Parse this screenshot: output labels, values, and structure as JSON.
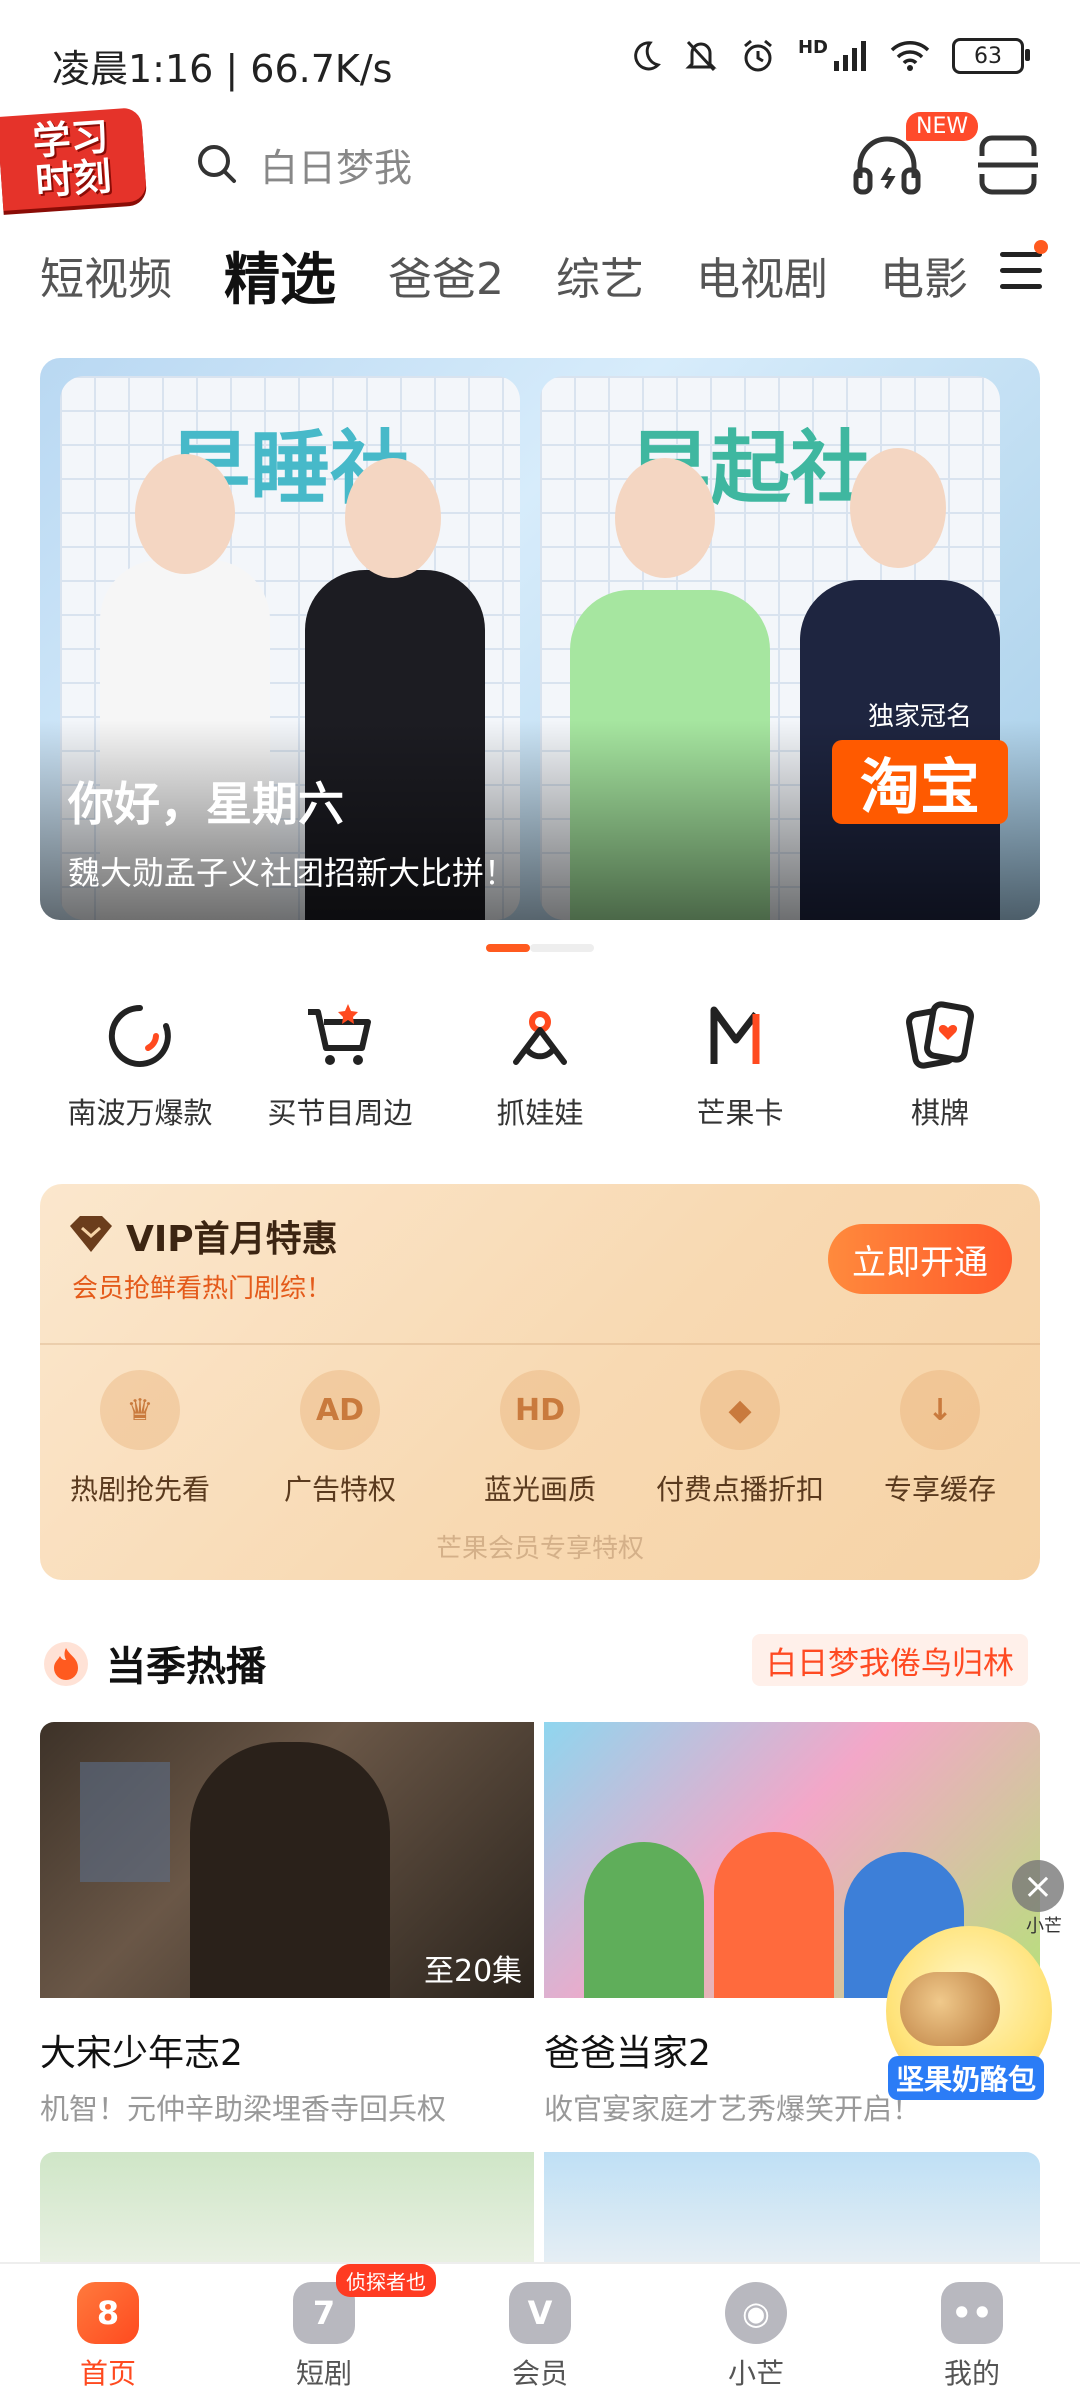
{
  "status_bar": {
    "time": "凌晨1:16 | 66.7K/s",
    "battery": "63",
    "net_type": "HD"
  },
  "header": {
    "logo_line1": "学习",
    "logo_line2": "时刻",
    "search_placeholder": "白日梦我",
    "new_badge": "NEW"
  },
  "tabs": [
    {
      "label": "短视频"
    },
    {
      "label": "精选"
    },
    {
      "label": "爸爸2"
    },
    {
      "label": "综艺"
    },
    {
      "label": "电视剧"
    },
    {
      "label": "电影"
    }
  ],
  "banner": {
    "board_left": "早睡社",
    "board_right": "早起社",
    "title": "你好，星期六",
    "subtitle": "魏大勋孟子义社团招新大比拼！",
    "sponsor_label": "独家冠名",
    "sponsor_name": "淘宝",
    "carousel_active_index": 0
  },
  "quick_entries": [
    {
      "label": "南波万爆款",
      "icon": "circle-swoosh-icon"
    },
    {
      "label": "买节目周边",
      "icon": "shopping-cart-icon"
    },
    {
      "label": "抓娃娃",
      "icon": "claw-machine-icon"
    },
    {
      "label": "芒果卡",
      "icon": "mango-m-icon"
    },
    {
      "label": "棋牌",
      "icon": "cards-icon"
    }
  ],
  "vip": {
    "title": "VIP首月特惠",
    "subtitle": "会员抢鲜看热门剧综！",
    "button": "立即开通",
    "perks": [
      {
        "label": "热剧抢先看",
        "icon": "sofa-icon",
        "glyph": "♛"
      },
      {
        "label": "广告特权",
        "icon": "ad-icon",
        "glyph": "AD"
      },
      {
        "label": "蓝光画质",
        "icon": "hd-icon",
        "glyph": "HD"
      },
      {
        "label": "付费点播折扣",
        "icon": "tag-icon",
        "glyph": "◆"
      },
      {
        "label": "专享缓存",
        "icon": "download-icon",
        "glyph": "↓"
      }
    ],
    "footer": "芒果会员专享特权"
  },
  "section": {
    "title": "当季热播",
    "tag": "白日梦我倦鸟归林"
  },
  "cards": [
    {
      "title": "大宋少年志2",
      "subtitle": "机智！元仲辛助梁埋香寺回兵权",
      "episodes": "至20集"
    },
    {
      "title": "爸爸当家2",
      "subtitle": "收官宴家庭才艺秀爆笑开启！"
    }
  ],
  "float_ad": {
    "brand": "小芒",
    "label": "坚果奶酪包"
  },
  "nav": [
    {
      "label": "首页",
      "glyph": "8",
      "active": true
    },
    {
      "label": "短剧",
      "glyph": "7",
      "badge": "侦探者也"
    },
    {
      "label": "会员",
      "glyph": "V"
    },
    {
      "label": "小芒",
      "glyph": "◉"
    },
    {
      "label": "我的",
      "glyph": "••"
    }
  ],
  "colors": {
    "accent": "#ff5a1f",
    "vip_text": "#e45a1a",
    "tag_text": "#ff4a22"
  }
}
